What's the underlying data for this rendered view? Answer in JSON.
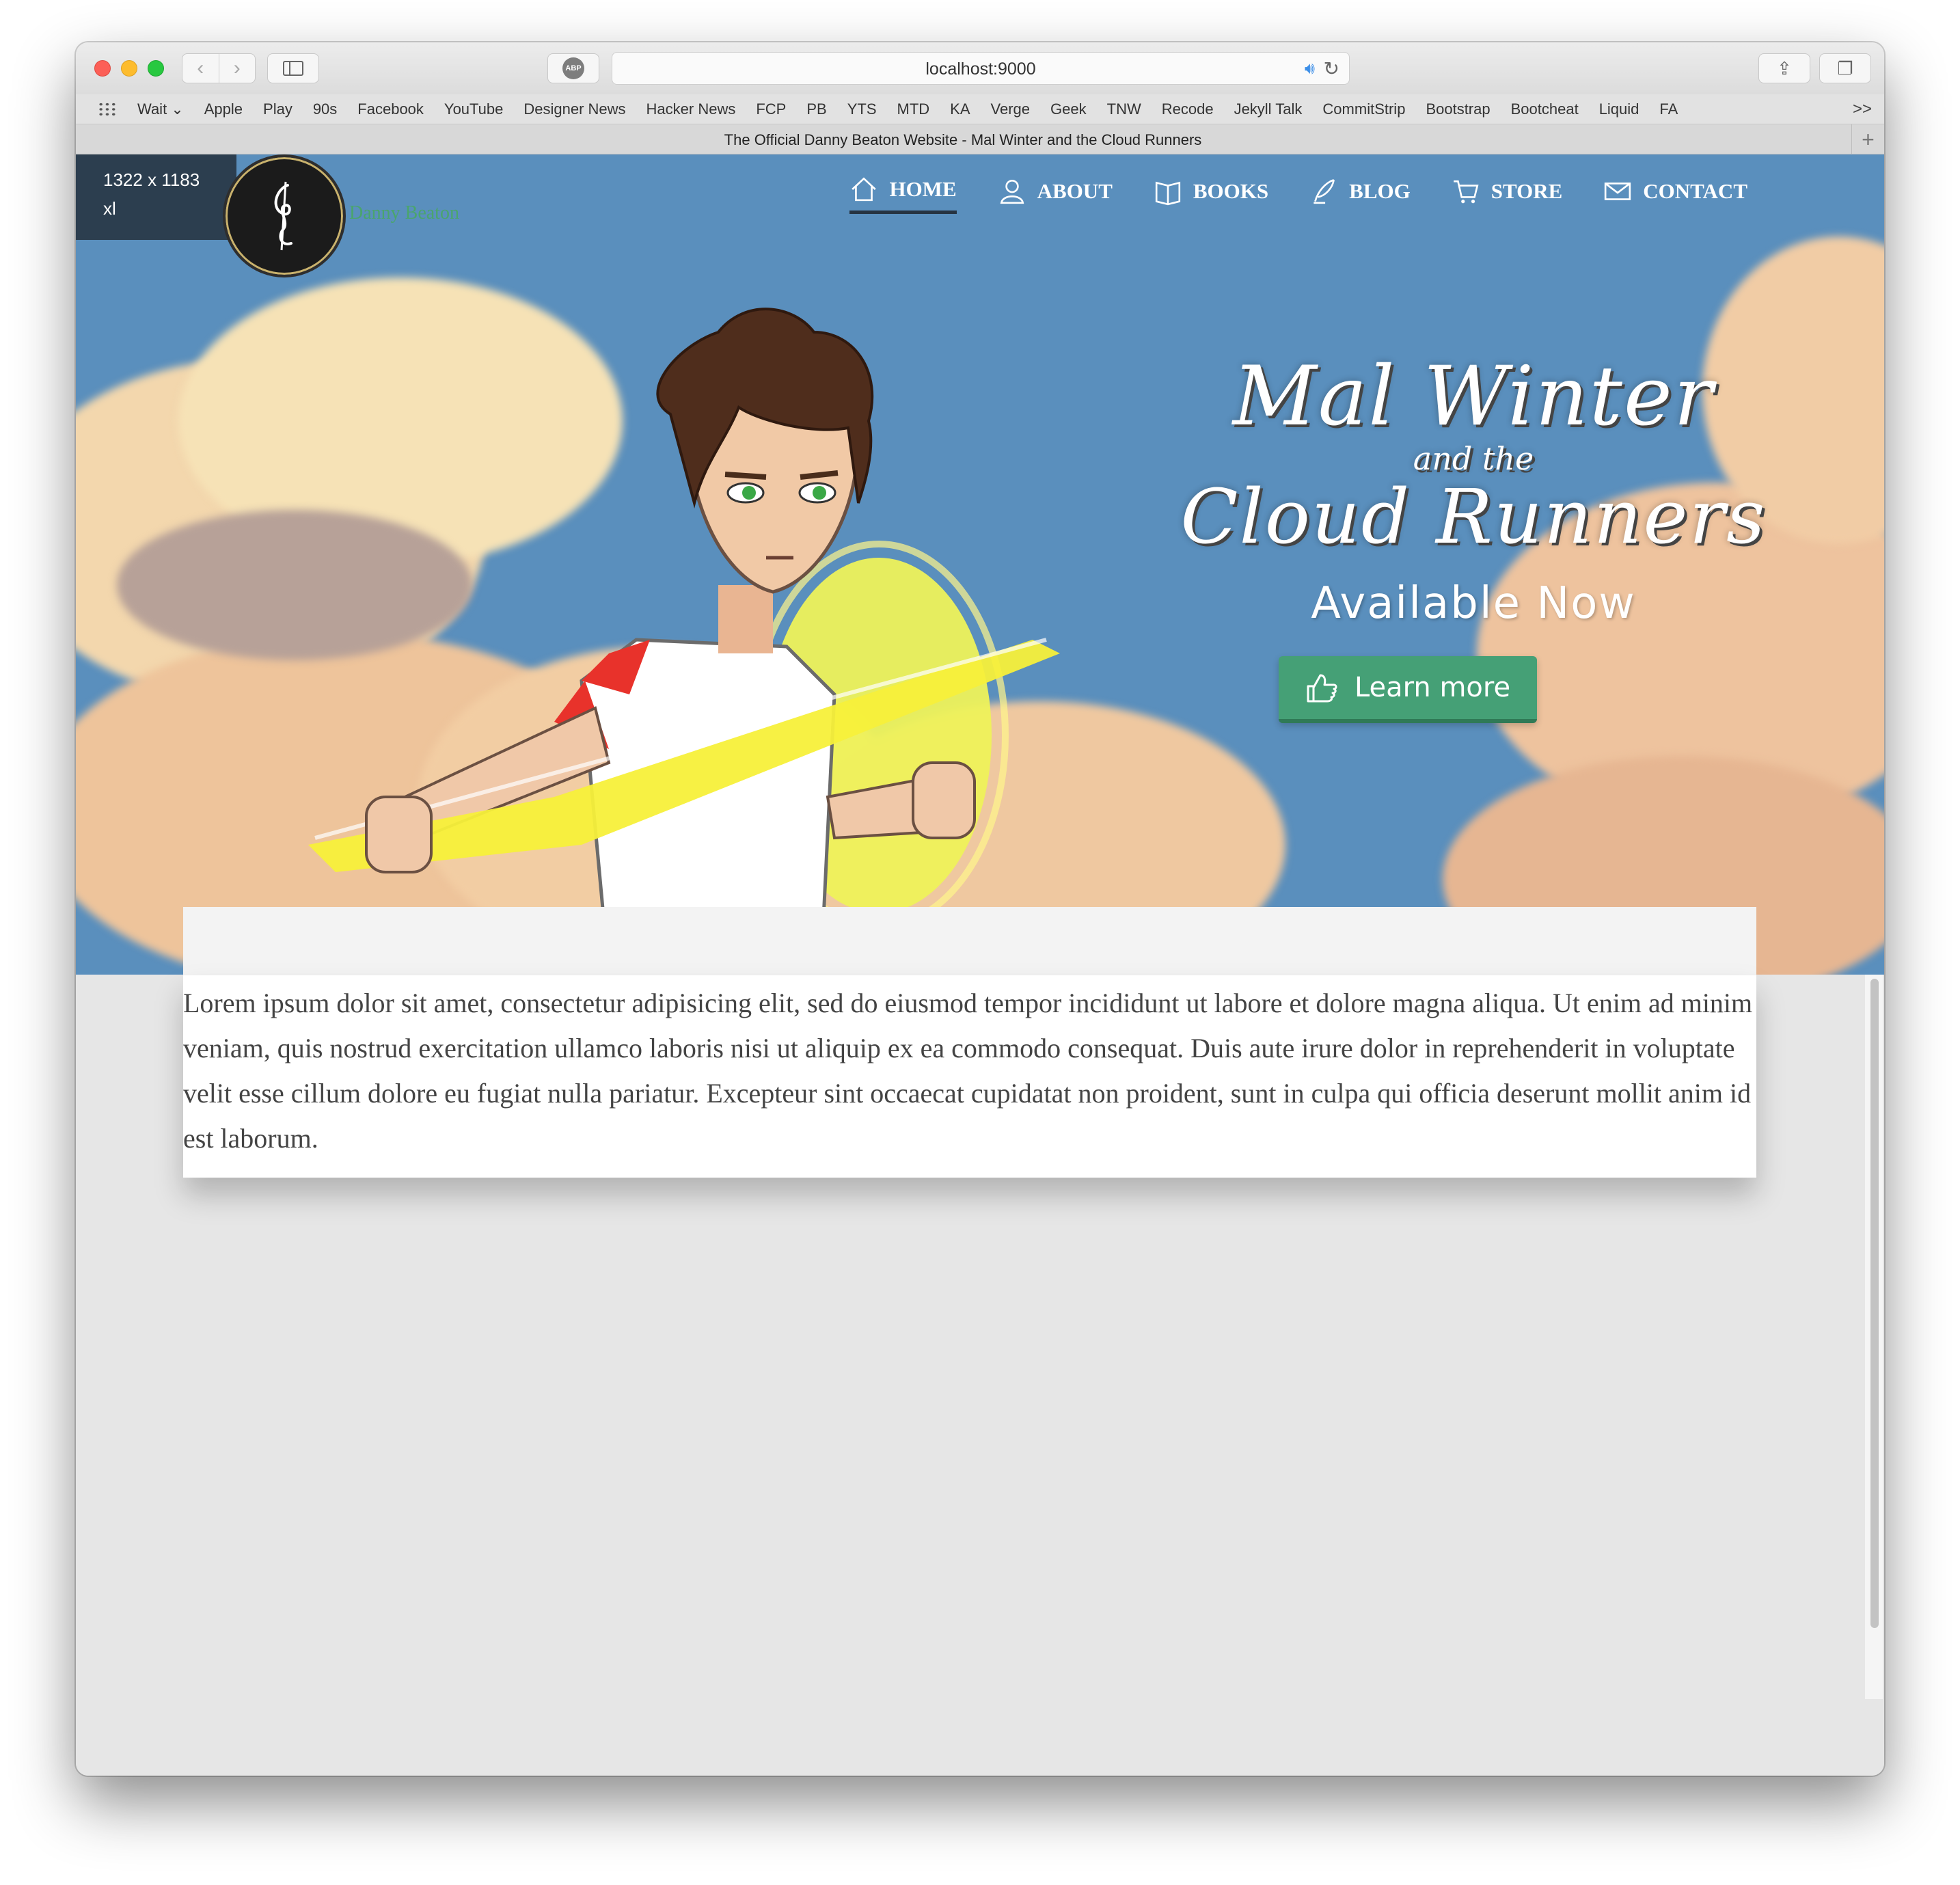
{
  "browser": {
    "url": "localhost:9000",
    "tab_title": "The Official Danny Beaton Website - Mal Winter and the Cloud Runners",
    "abp_label": "ABP",
    "more_label": ">>",
    "bookmarks": [
      "Wait ⌄",
      "Apple",
      "Play",
      "90s",
      "Facebook",
      "YouTube",
      "Designer News",
      "Hacker News",
      "FCP",
      "PB",
      "YTS",
      "MTD",
      "KA",
      "Verge",
      "Geek",
      "TNW",
      "Recode",
      "Jekyll Talk",
      "CommitStrip",
      "Bootstrap",
      "Bootcheat",
      "Liquid",
      "FA"
    ]
  },
  "breakpoint": {
    "size": "1322 x 1183",
    "name": "xl"
  },
  "site": {
    "logo_text": "Danny Beaton",
    "nav": [
      {
        "label": "HOME",
        "icon": "home-icon",
        "active": true
      },
      {
        "label": "ABOUT",
        "icon": "user-icon",
        "active": false
      },
      {
        "label": "BOOKS",
        "icon": "book-icon",
        "active": false
      },
      {
        "label": "BLOG",
        "icon": "quill-icon",
        "active": false
      },
      {
        "label": "STORE",
        "icon": "cart-icon",
        "active": false
      },
      {
        "label": "CONTACT",
        "icon": "envelope-icon",
        "active": false
      }
    ]
  },
  "hero": {
    "title_line1": "Mal Winter",
    "title_line2": "and the",
    "title_line3": "Cloud Runners",
    "subtitle": "Available Now",
    "cta_label": "Learn more",
    "cta_icon": "thumbs-up-icon",
    "colors": {
      "sky": "#5a8fbd",
      "cta": "#45a076",
      "nav_underline": "#263341"
    }
  },
  "content": {
    "paragraph": "Lorem ipsum dolor sit amet, consectetur adipisicing elit, sed do eiusmod tempor incididunt ut labore et dolore magna aliqua. Ut enim ad minim veniam, quis nostrud exercitation ullamco laboris nisi ut aliquip ex ea commodo consequat. Duis aute irure dolor in reprehenderit in voluptate velit esse cillum dolore eu fugiat nulla pariatur. Excepteur sint occaecat cupidatat non proident, sunt in culpa qui officia deserunt mollit anim id est laborum."
  }
}
